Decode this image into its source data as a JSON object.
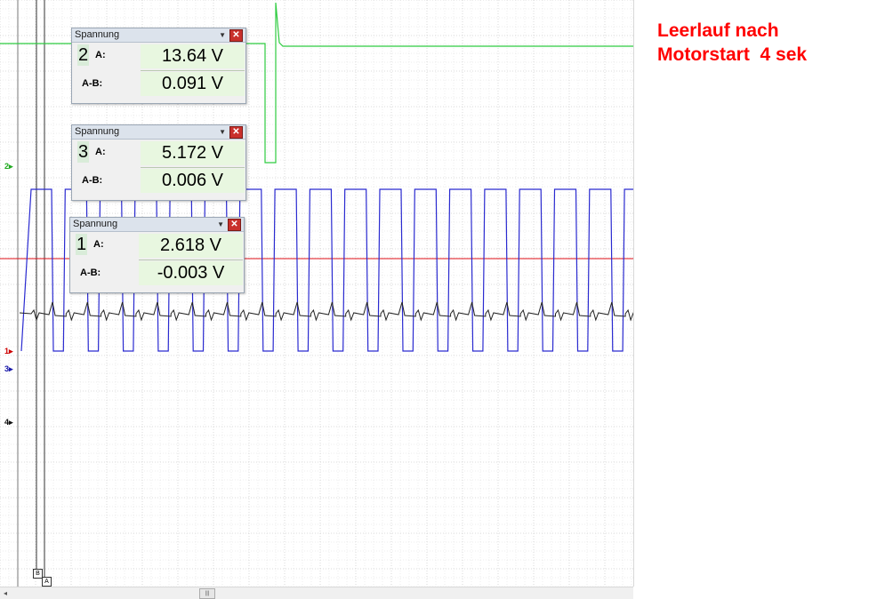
{
  "annotation": {
    "line1": "Leerlauf nach",
    "line2": "Motorstart  4 sek"
  },
  "channel_markers": [
    {
      "id": "2",
      "color": "#22aa22"
    },
    {
      "id": "1",
      "color": "#cc0000"
    },
    {
      "id": "3",
      "color": "#1a1aaa"
    },
    {
      "id": "4",
      "color": "#111111"
    }
  ],
  "cursors": {
    "b_label": "B",
    "a_label": "A"
  },
  "panels": [
    {
      "title": "Spannung",
      "channel": "2",
      "a_label": "A:",
      "a_value": "13.64 V",
      "ab_label": "A-B:",
      "ab_value": "0.091 V"
    },
    {
      "title": "Spannung",
      "channel": "3",
      "a_label": "A:",
      "a_value": "5.172 V",
      "ab_label": "A-B:",
      "ab_value": "0.006 V"
    },
    {
      "title": "Spannung",
      "channel": "1",
      "a_label": "A:",
      "a_value": "2.618 V",
      "ab_label": "A-B:",
      "ab_value": "-0.003 V"
    }
  ],
  "scrollbar": {
    "left_arrow": "◂",
    "thumb": "|||"
  },
  "colors": {
    "trace_green": "#2ecc40",
    "trace_blue": "#2a2ad0",
    "trace_red": "#e0101a",
    "trace_black": "#222222",
    "grid": "#cfcfcf"
  }
}
